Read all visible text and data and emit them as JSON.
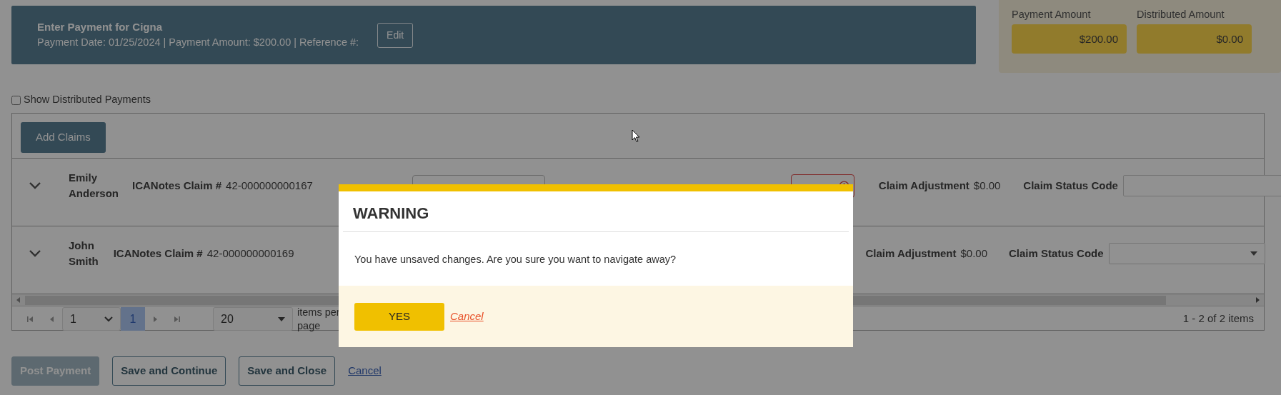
{
  "header": {
    "title": "Enter Payment for Cigna",
    "details": "Payment Date: 01/25/2024 | Payment Amount: $200.00 | Reference #:",
    "edit_button": "Edit"
  },
  "summary": [
    {
      "label": "Payment Amount",
      "value": "$200.00"
    },
    {
      "label": "Distributed Amount",
      "value": "$0.00"
    }
  ],
  "show_distributed": {
    "label": "Show Distributed Payments",
    "checked": false
  },
  "toolbar": {
    "add_button": "Add Claims"
  },
  "claims": [
    {
      "name": "Emily Anderson",
      "expanded": false,
      "claim_label": "ICANotes Claim #",
      "claim_number": "42-000000000167",
      "cells": [
        {
          "kind": "text-input"
        },
        {
          "kind": "flagged-amount",
          "invalid": true
        },
        {
          "kind": "label-value",
          "label": "Claim Adjustment",
          "value": "$0.00"
        },
        {
          "kind": "label-input",
          "label": "Claim Status Code"
        }
      ]
    },
    {
      "name": "John Smith",
      "expanded": false,
      "claim_label": "ICANotes Claim #",
      "claim_number": "42-000000000169",
      "cells": [
        {
          "kind": "label-value",
          "label": "Claim Adjustment",
          "value": "$0.00"
        },
        {
          "kind": "label-select",
          "label": "Claim Status Code"
        }
      ]
    }
  ],
  "pager": {
    "page_select": "1",
    "pages": [
      {
        "label": "1",
        "selected": true
      }
    ],
    "page_size": "20",
    "page_size_label": "items per page",
    "summary": "1 - 2 of 2 items"
  },
  "actions": [
    {
      "kind": "solid",
      "label": "Post Payment",
      "disabled": true
    },
    {
      "kind": "outline",
      "label": "Save and Continue",
      "disabled": false
    },
    {
      "kind": "outline",
      "label": "Save and Close",
      "disabled": false
    },
    {
      "kind": "link",
      "label": "Cancel",
      "disabled": false
    }
  ],
  "modal": {
    "title": "WARNING",
    "message": "You have unsaved changes. Are you sure you want to navigate away?",
    "confirm": "YES",
    "cancel": "Cancel"
  }
}
